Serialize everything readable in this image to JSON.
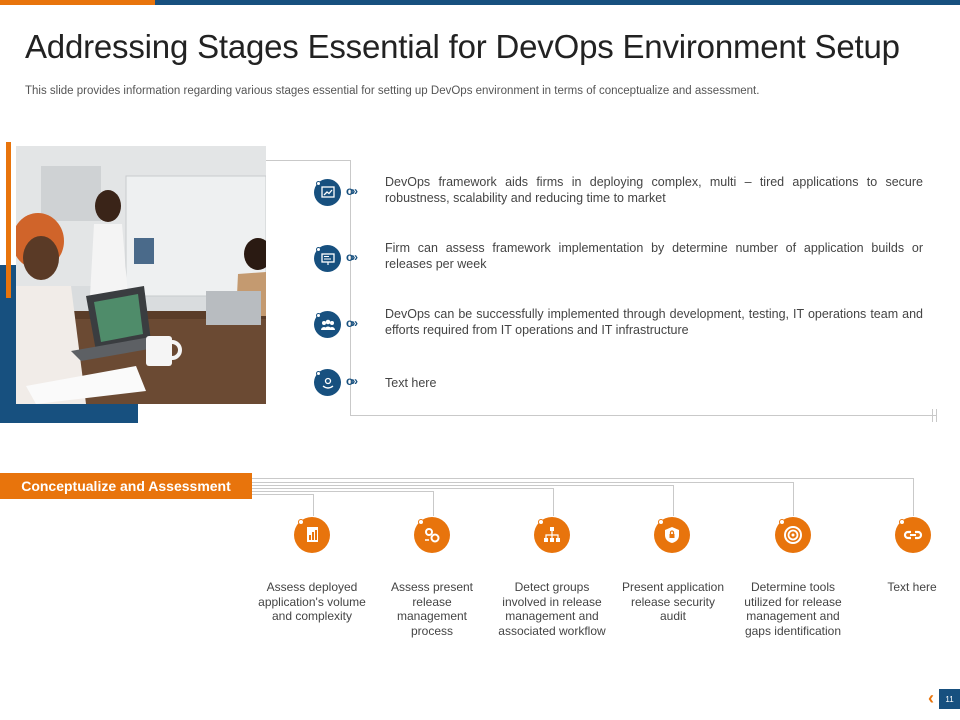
{
  "slide": {
    "title": "Addressing Stages Essential for DevOps Environment Setup",
    "subtitle": "This slide provides information regarding various stages essential for setting up DevOps environment in terms of conceptualize and assessment.",
    "page_number": "11"
  },
  "colors": {
    "accent_orange": "#e8740c",
    "accent_blue": "#17507f"
  },
  "points": [
    {
      "icon": "chart-icon",
      "text": "DevOps framework aids firms in deploying complex, multi – tired applications to secure robustness, scalability and reducing time to market"
    },
    {
      "icon": "presentation-board-icon",
      "text": "Firm can assess framework implementation by determine number of application builds or releases per week"
    },
    {
      "icon": "team-icon",
      "text": "DevOps can be successfully implemented through development, testing, IT operations team and efforts required from IT operations and IT infrastructure"
    },
    {
      "icon": "hand-gear-icon",
      "text": "Text here"
    }
  ],
  "section_label": "Conceptualize and Assessment",
  "stages": [
    {
      "icon": "document-chart-icon",
      "text": "Assess deployed application's volume and complexity"
    },
    {
      "icon": "gears-process-icon",
      "text": "Assess present release management process"
    },
    {
      "icon": "hierarchy-icon",
      "text": "Detect groups involved in release management and associated workflow"
    },
    {
      "icon": "shield-lock-icon",
      "text": "Present application release security audit"
    },
    {
      "icon": "target-icon",
      "text": "Determine tools utilized for release management and gaps identification"
    },
    {
      "icon": "link-icon",
      "text": "Text here"
    }
  ]
}
